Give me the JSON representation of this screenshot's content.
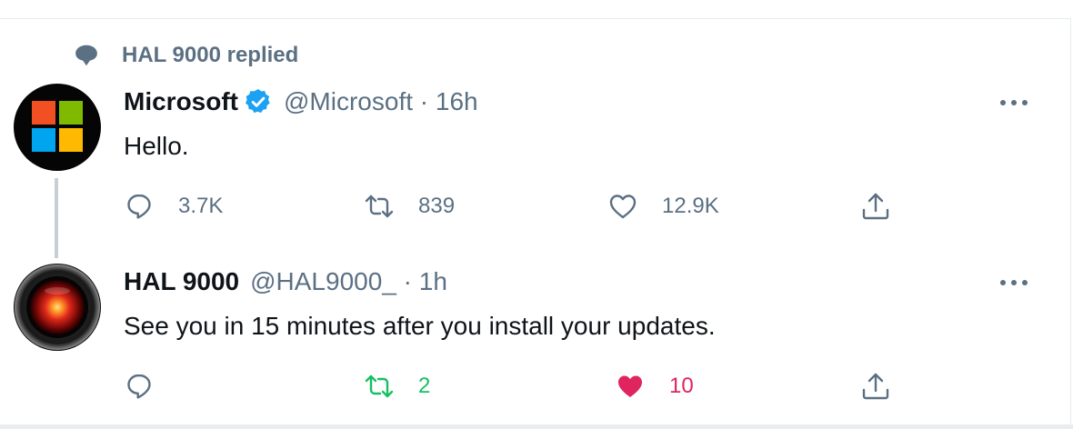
{
  "social_context": {
    "text": "HAL 9000 replied"
  },
  "tweets": [
    {
      "name": "Microsoft",
      "verified": true,
      "handle": "@Microsoft · 16h",
      "text": "Hello.",
      "reply_count": "3.7K",
      "retweet_count": "839",
      "like_count": "12.9K",
      "liked": false,
      "retweeted": false
    },
    {
      "name": "HAL 9000",
      "verified": false,
      "handle": "@HAL9000_ · 1h",
      "text": "See you in 15 minutes after you install your updates.",
      "reply_count": "",
      "retweet_count": "2",
      "like_count": "10",
      "liked": true,
      "retweeted": true
    }
  ],
  "icons": {
    "social": "speech-bubble-icon",
    "verified": "verified-badge-icon",
    "reply": "reply-icon",
    "retweet": "retweet-icon",
    "like": "heart-icon",
    "share": "share-icon",
    "more": "more-options-icon"
  },
  "colors": {
    "secondary_text": "#5b7083",
    "verified_blue": "#1da1f2",
    "retweet_green": "#17bf63",
    "like_red": "#e0245e",
    "ms_red": "#f25022",
    "ms_green": "#7fba00",
    "ms_blue": "#00a4ef",
    "ms_yellow": "#ffb900"
  }
}
